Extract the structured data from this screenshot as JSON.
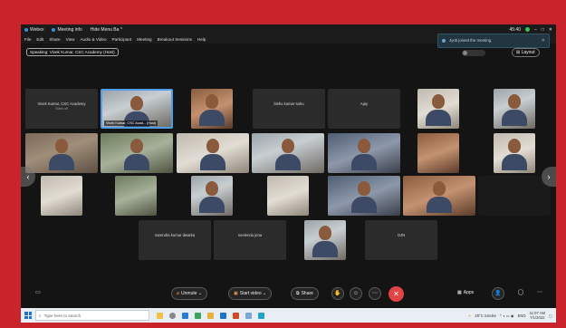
{
  "window": {
    "app_name": "Webex",
    "tabs": [
      "Meeting info",
      "Hide Menu Ba"
    ],
    "clock": "45:40",
    "controls": [
      "–",
      "□",
      "✕"
    ]
  },
  "menu": [
    "File",
    "Edit",
    "Share",
    "View",
    "Audio & Video",
    "Participant",
    "Meeting",
    "Breakout Sessions",
    "Help"
  ],
  "speaking": "Speaking: Vivek Kumar, CSC Academy (Host)",
  "layout_label": "Layout",
  "notification": "Jyoti joined the meeting.",
  "tiles": [
    {
      "label": "Vivek Kumar, CSC Academy",
      "sub": "Video off"
    },
    {
      "label": "Vivek Kumar, CSC Acad... (Host)"
    },
    {
      "label": "bishu kumar sahu"
    },
    {
      "label": "Ajay"
    },
    {
      "label": "narendra kumar dwarka"
    },
    {
      "label": "neelendu jena"
    },
    {
      "label": "OJN"
    }
  ],
  "controls": {
    "unmute": "Unmute",
    "start_video": "Start video",
    "share": "Share",
    "apps": "Apps"
  },
  "taskbar": {
    "search_placeholder": "Type here to search",
    "weather": "29°C Smoke",
    "lang": "ENG",
    "time": "11:07 AM",
    "date": "7/1/2022"
  }
}
